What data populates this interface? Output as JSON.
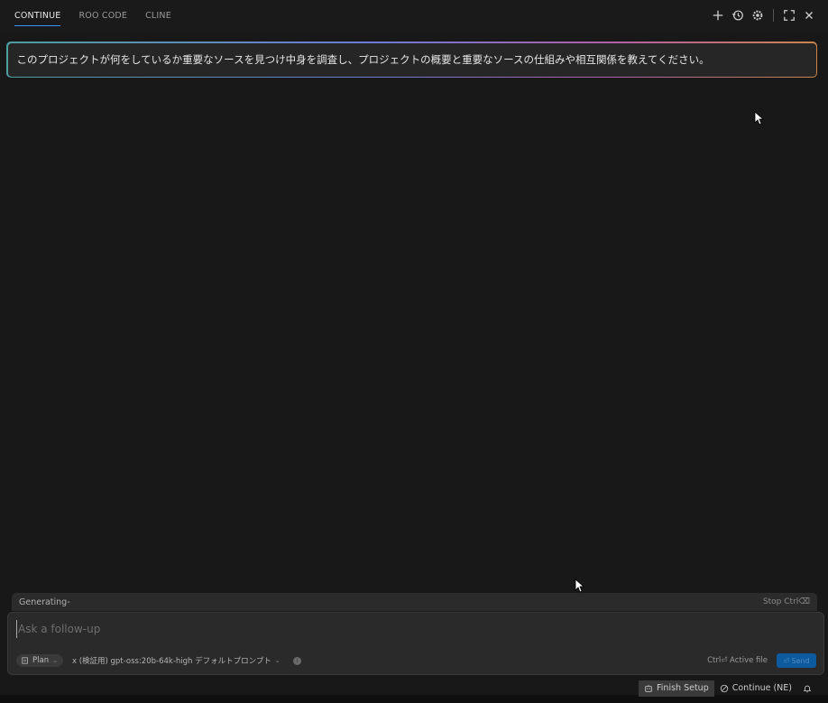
{
  "tabs": [
    {
      "label": "CONTINUE",
      "active": true
    },
    {
      "label": "ROO CODE",
      "active": false
    },
    {
      "label": "CLINE",
      "active": false
    }
  ],
  "toolbar_icons": [
    "plus-icon",
    "history-icon",
    "gear-icon",
    "maximize-icon",
    "close-icon"
  ],
  "prompt": {
    "text": "このプロジェクトが何をしているか重要なソースを見つけ中身を調査し、プロジェクトの概要と重要なソースの仕組みや相互関係を教えてください。"
  },
  "generating": {
    "status": "Generating-",
    "stop_label": "Stop Ctrl⌫"
  },
  "input": {
    "placeholder": "Ask a follow-up",
    "value": ""
  },
  "input_toolbar": {
    "mode": "Plan",
    "model": "x (検証用) gpt-oss:20b-64k-high デフォルトプロンプト",
    "active_file": "Ctrl⏎ Active file",
    "send_label": "⏎ Send"
  },
  "status_bar": {
    "finish_setup": "Finish Setup",
    "continue_label": "Continue (NE)"
  },
  "colors": {
    "accent": "#3794ff",
    "background": "#181818",
    "send_button": "#0e5a9e"
  }
}
